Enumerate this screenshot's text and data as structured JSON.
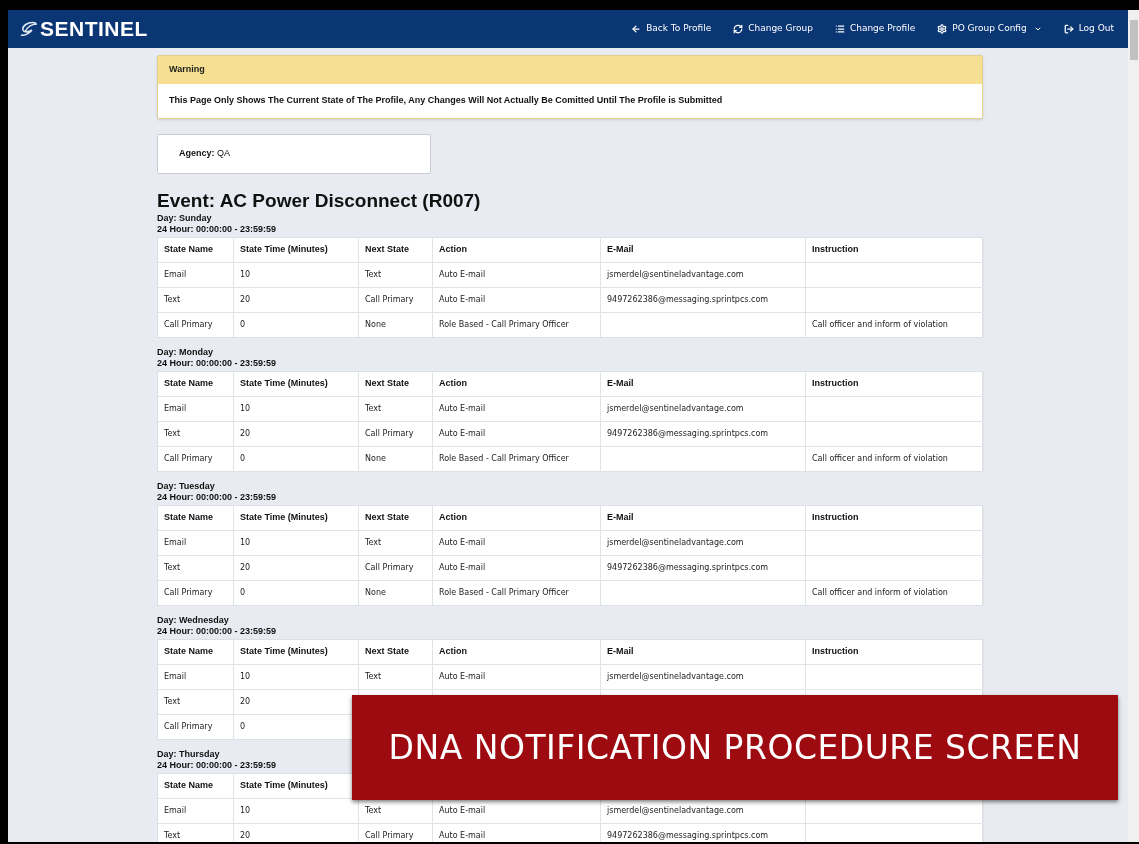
{
  "navbar": {
    "logo": "SENTINEL",
    "items": [
      {
        "label": "Back To Profile",
        "dropdown": false
      },
      {
        "label": "Change Group",
        "dropdown": false
      },
      {
        "label": "Change Profile",
        "dropdown": false
      },
      {
        "label": "PO Group Config",
        "dropdown": true
      },
      {
        "label": "Log Out",
        "dropdown": false
      }
    ]
  },
  "warning": {
    "title": "Warning",
    "message": "This Page Only Shows The Current State of The Profile, Any Changes Will Not Actually Be Comitted Until The Profile is Submitted"
  },
  "agency": {
    "label": "Agency:",
    "value": "QA"
  },
  "event_title": "Event: AC Power Disconnect (R007)",
  "days": [
    {
      "day": "Day: Sunday",
      "hours": "24 Hour: 00:00:00 - 23:59:59",
      "columns": [
        "State Name",
        "State Time (Minutes)",
        "Next State",
        "Action",
        "E-Mail",
        "Instruction"
      ],
      "rows": [
        {
          "state_name": "Email",
          "state_time": "10",
          "next_state": "Text",
          "action": "Auto E-mail",
          "email": "jsmerdel@sentineladvantage.com"
        },
        {
          "state_name": "Text",
          "state_time": "20",
          "next_state": "Call Primary",
          "action": "Auto E-mail",
          "email": "9497262386@messaging.sprintpcs.com"
        },
        {
          "state_name": "Call Primary",
          "state_time": "0",
          "next_state": "None",
          "action": "Role Based - Call Primary Officer",
          "instruction": "Call officer and inform of violation"
        }
      ]
    },
    {
      "day": "Day: Monday",
      "hours": "24 Hour: 00:00:00 - 23:59:59",
      "columns": [
        "State Name",
        "State Time (Minutes)",
        "Next State",
        "Action",
        "E-Mail",
        "Instruction"
      ],
      "rows": [
        {
          "state_name": "Email",
          "state_time": "10",
          "next_state": "Text",
          "action": "Auto E-mail",
          "email": "jsmerdel@sentineladvantage.com"
        },
        {
          "state_name": "Text",
          "state_time": "20",
          "next_state": "Call Primary",
          "action": "Auto E-mail",
          "email": "9497262386@messaging.sprintpcs.com"
        },
        {
          "state_name": "Call Primary",
          "state_time": "0",
          "next_state": "None",
          "action": "Role Based - Call Primary Officer",
          "instruction": "Call officer and inform of violation"
        }
      ]
    },
    {
      "day": "Day: Tuesday",
      "hours": "24 Hour: 00:00:00 - 23:59:59",
      "columns": [
        "State Name",
        "State Time (Minutes)",
        "Next State",
        "Action",
        "E-Mail",
        "Instruction"
      ],
      "rows": [
        {
          "state_name": "Email",
          "state_time": "10",
          "next_state": "Text",
          "action": "Auto E-mail",
          "email": "jsmerdel@sentineladvantage.com"
        },
        {
          "state_name": "Text",
          "state_time": "20",
          "next_state": "Call Primary",
          "action": "Auto E-mail",
          "email": "9497262386@messaging.sprintpcs.com"
        },
        {
          "state_name": "Call Primary",
          "state_time": "0",
          "next_state": "None",
          "action": "Role Based - Call Primary Officer",
          "instruction": "Call officer and inform of violation"
        }
      ]
    },
    {
      "day": "Day: Wednesday",
      "hours": "24 Hour: 00:00:00 - 23:59:59",
      "columns": [
        "State Name",
        "State Time (Minutes)",
        "Next State",
        "Action",
        "E-Mail",
        "Instruction"
      ],
      "rows": [
        {
          "state_name": "Email",
          "state_time": "10",
          "next_state": "Text",
          "action": "Auto E-mail",
          "email": "jsmerdel@sentineladvantage.com"
        },
        {
          "state_name": "Text",
          "state_time": "20"
        },
        {
          "state_name": "Call Primary",
          "state_time": "0"
        }
      ]
    },
    {
      "day": "Day: Thursday",
      "hours": "24 Hour: 00:00:00 - 23:59:59",
      "columns": [
        "State Name",
        "State Time (Minutes)"
      ],
      "rows": [
        {
          "state_name": "Email",
          "state_time": "10",
          "next_state": "Text",
          "action": "Auto E-mail",
          "email": "jsmerdel@sentineladvantage.com"
        },
        {
          "state_name": "Text",
          "state_time": "20",
          "next_state": "Call Primary",
          "action": "Auto E-mail",
          "email": "9497262386@messaging.sprintpcs.com"
        }
      ]
    }
  ],
  "overlay_caption": "DNA NOTIFICATION PROCEDURE SCREEN"
}
